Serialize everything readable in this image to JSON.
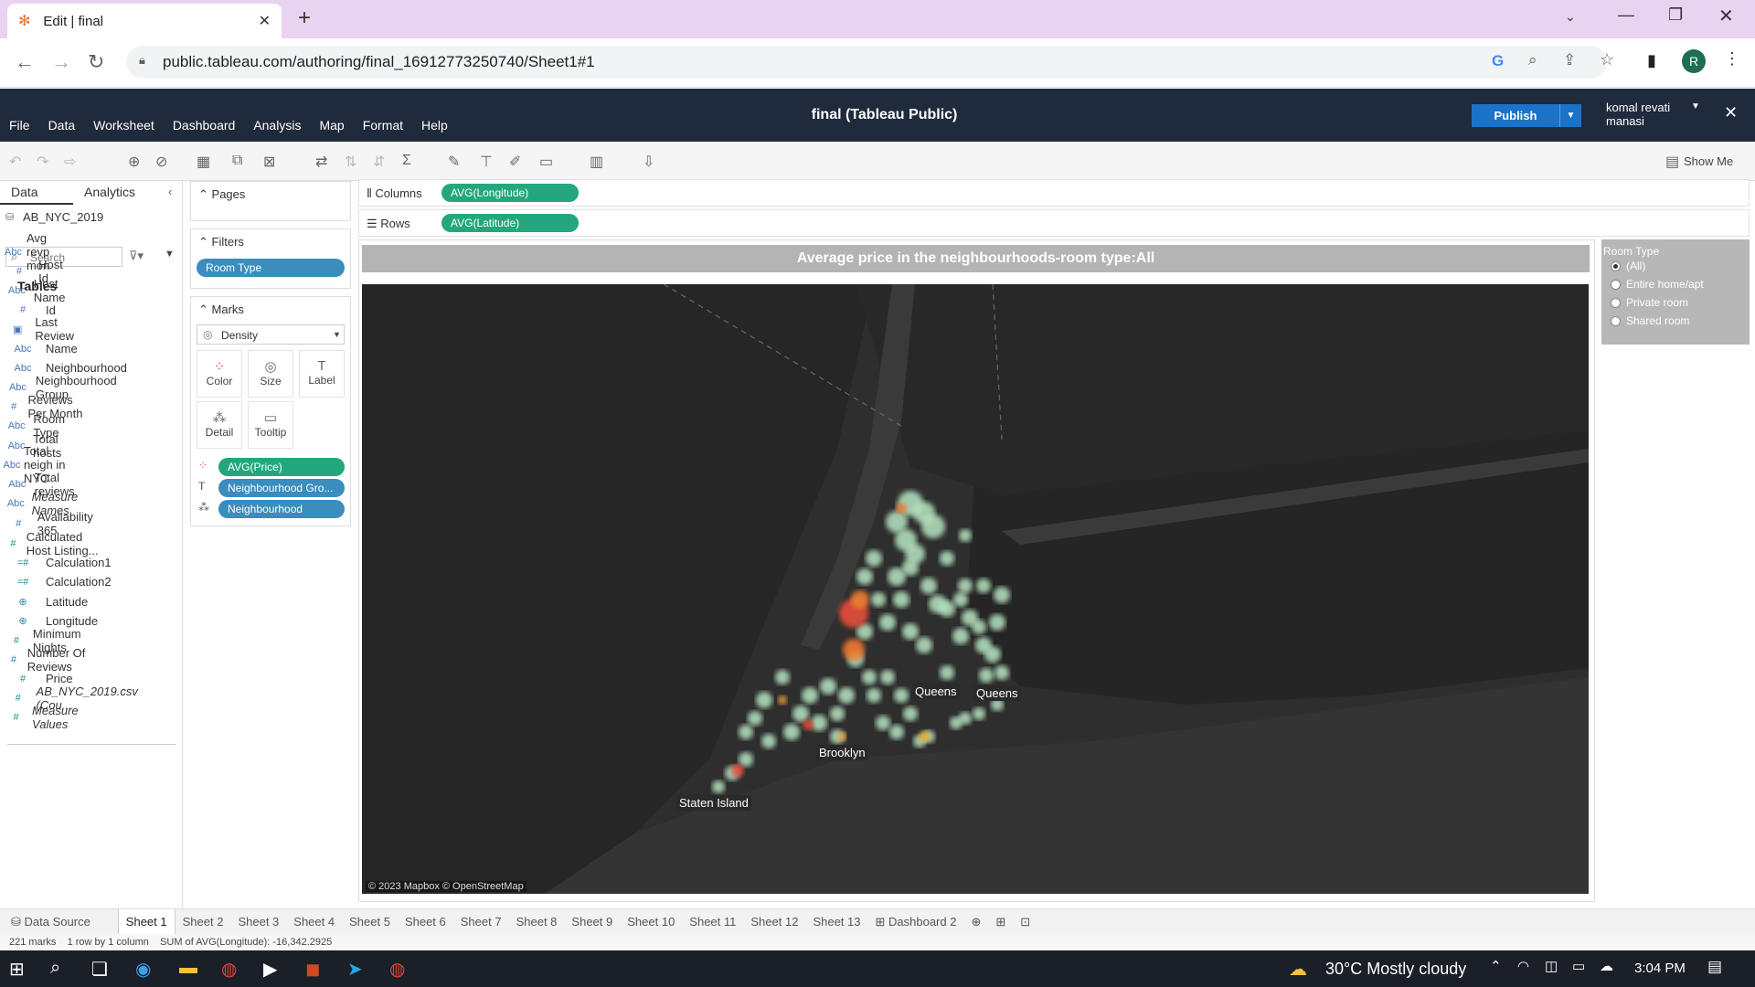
{
  "browser": {
    "tab_title": "Edit | final",
    "url": "public.tableau.com/authoring/final_16912773250740/Sheet1#1",
    "profile_initial": "R"
  },
  "tableau": {
    "workbook_title": "final (Tableau Public)",
    "menus": [
      "File",
      "Data",
      "Worksheet",
      "Dashboard",
      "Analysis",
      "Map",
      "Format",
      "Help"
    ],
    "publish_label": "Publish",
    "user_line1": "komal revati",
    "user_line2": "manasi",
    "show_me": "Show Me"
  },
  "left_pane": {
    "tab_data": "Data",
    "tab_analytics": "Analytics",
    "datasource": "AB_NYC_2019",
    "search_placeholder": "Search",
    "tables_header": "Tables",
    "fields": [
      {
        "name": "Avg revp mon",
        "type": "Abc",
        "italic": false
      },
      {
        "name": "Host Id",
        "type": "#",
        "italic": false
      },
      {
        "name": "Host Name",
        "type": "Abc",
        "italic": false
      },
      {
        "name": "Id",
        "type": "#",
        "italic": false
      },
      {
        "name": "Last Review",
        "type": "date",
        "italic": false
      },
      {
        "name": "Name",
        "type": "Abc",
        "italic": false
      },
      {
        "name": "Neighbourhood",
        "type": "Abc",
        "italic": false
      },
      {
        "name": "Neighbourhood Group",
        "type": "Abc",
        "italic": false
      },
      {
        "name": "Reviews Per Month",
        "type": "#",
        "italic": false
      },
      {
        "name": "Room Type",
        "type": "Abc",
        "italic": false
      },
      {
        "name": "Total hosts",
        "type": "Abc",
        "italic": false
      },
      {
        "name": "Total neigh in NYC",
        "type": "Abc",
        "italic": false
      },
      {
        "name": "Total reviews",
        "type": "Abc",
        "italic": false
      },
      {
        "name": "Measure Names",
        "type": "Abc",
        "italic": true
      }
    ],
    "measures": [
      {
        "name": "Availability 365",
        "type": "#",
        "italic": false
      },
      {
        "name": "Calculated Host Listing...",
        "type": "#",
        "italic": false
      },
      {
        "name": "Calculation1",
        "type": "=#",
        "italic": false
      },
      {
        "name": "Calculation2",
        "type": "=#",
        "italic": false
      },
      {
        "name": "Latitude",
        "type": "geo",
        "italic": false
      },
      {
        "name": "Longitude",
        "type": "geo",
        "italic": false
      },
      {
        "name": "Minimum Nights",
        "type": "#",
        "italic": false
      },
      {
        "name": "Number Of Reviews",
        "type": "#",
        "italic": false
      },
      {
        "name": "Price",
        "type": "#",
        "italic": false
      },
      {
        "name": "AB_NYC_2019.csv (Cou...",
        "type": "#",
        "italic": true
      },
      {
        "name": "Measure Values",
        "type": "#",
        "italic": true
      }
    ]
  },
  "cards": {
    "pages": "Pages",
    "filters": "Filters",
    "filter_pill": "Room Type",
    "marks": "Marks",
    "mark_type": "Density",
    "mark_buttons": [
      "Color",
      "Size",
      "Label",
      "Detail",
      "Tooltip"
    ],
    "mark_pills": [
      "AVG(Price)",
      "Neighbourhood Gro...",
      "Neighbourhood"
    ]
  },
  "shelves": {
    "columns_label": "Columns",
    "columns_pill": "AVG(Longitude)",
    "rows_label": "Rows",
    "rows_pill": "AVG(Latitude)"
  },
  "view": {
    "title_prefix": "Average price in the neighbourhoods-room type:",
    "title_value": "All",
    "city_labels": [
      "Queens",
      "Queens",
      "Brooklyn",
      "Staten Island"
    ],
    "attribution": "© 2023 Mapbox  © OpenStreetMap"
  },
  "legend": {
    "title": "Room Type",
    "options": [
      "(All)",
      "Entire home/apt",
      "Private room",
      "Shared room"
    ],
    "selected": "(All)"
  },
  "sheet_tabs": {
    "data_source": "Data Source",
    "sheets": [
      "Sheet 1",
      "Sheet 2",
      "Sheet 3",
      "Sheet 4",
      "Sheet 5",
      "Sheet 6",
      "Sheet 7",
      "Sheet 8",
      "Sheet 9",
      "Sheet 10",
      "Sheet 11",
      "Sheet 12",
      "Sheet 13"
    ],
    "active": "Sheet 1",
    "dashboard": "Dashboard 2"
  },
  "status_bar": {
    "marks": "221 marks",
    "rows_cols": "1 row by 1 column",
    "sum": "SUM of AVG(Longitude): -16,342.2925"
  },
  "taskbar": {
    "weather": "30°C  Mostly cloudy",
    "time": "3:04 PM"
  }
}
